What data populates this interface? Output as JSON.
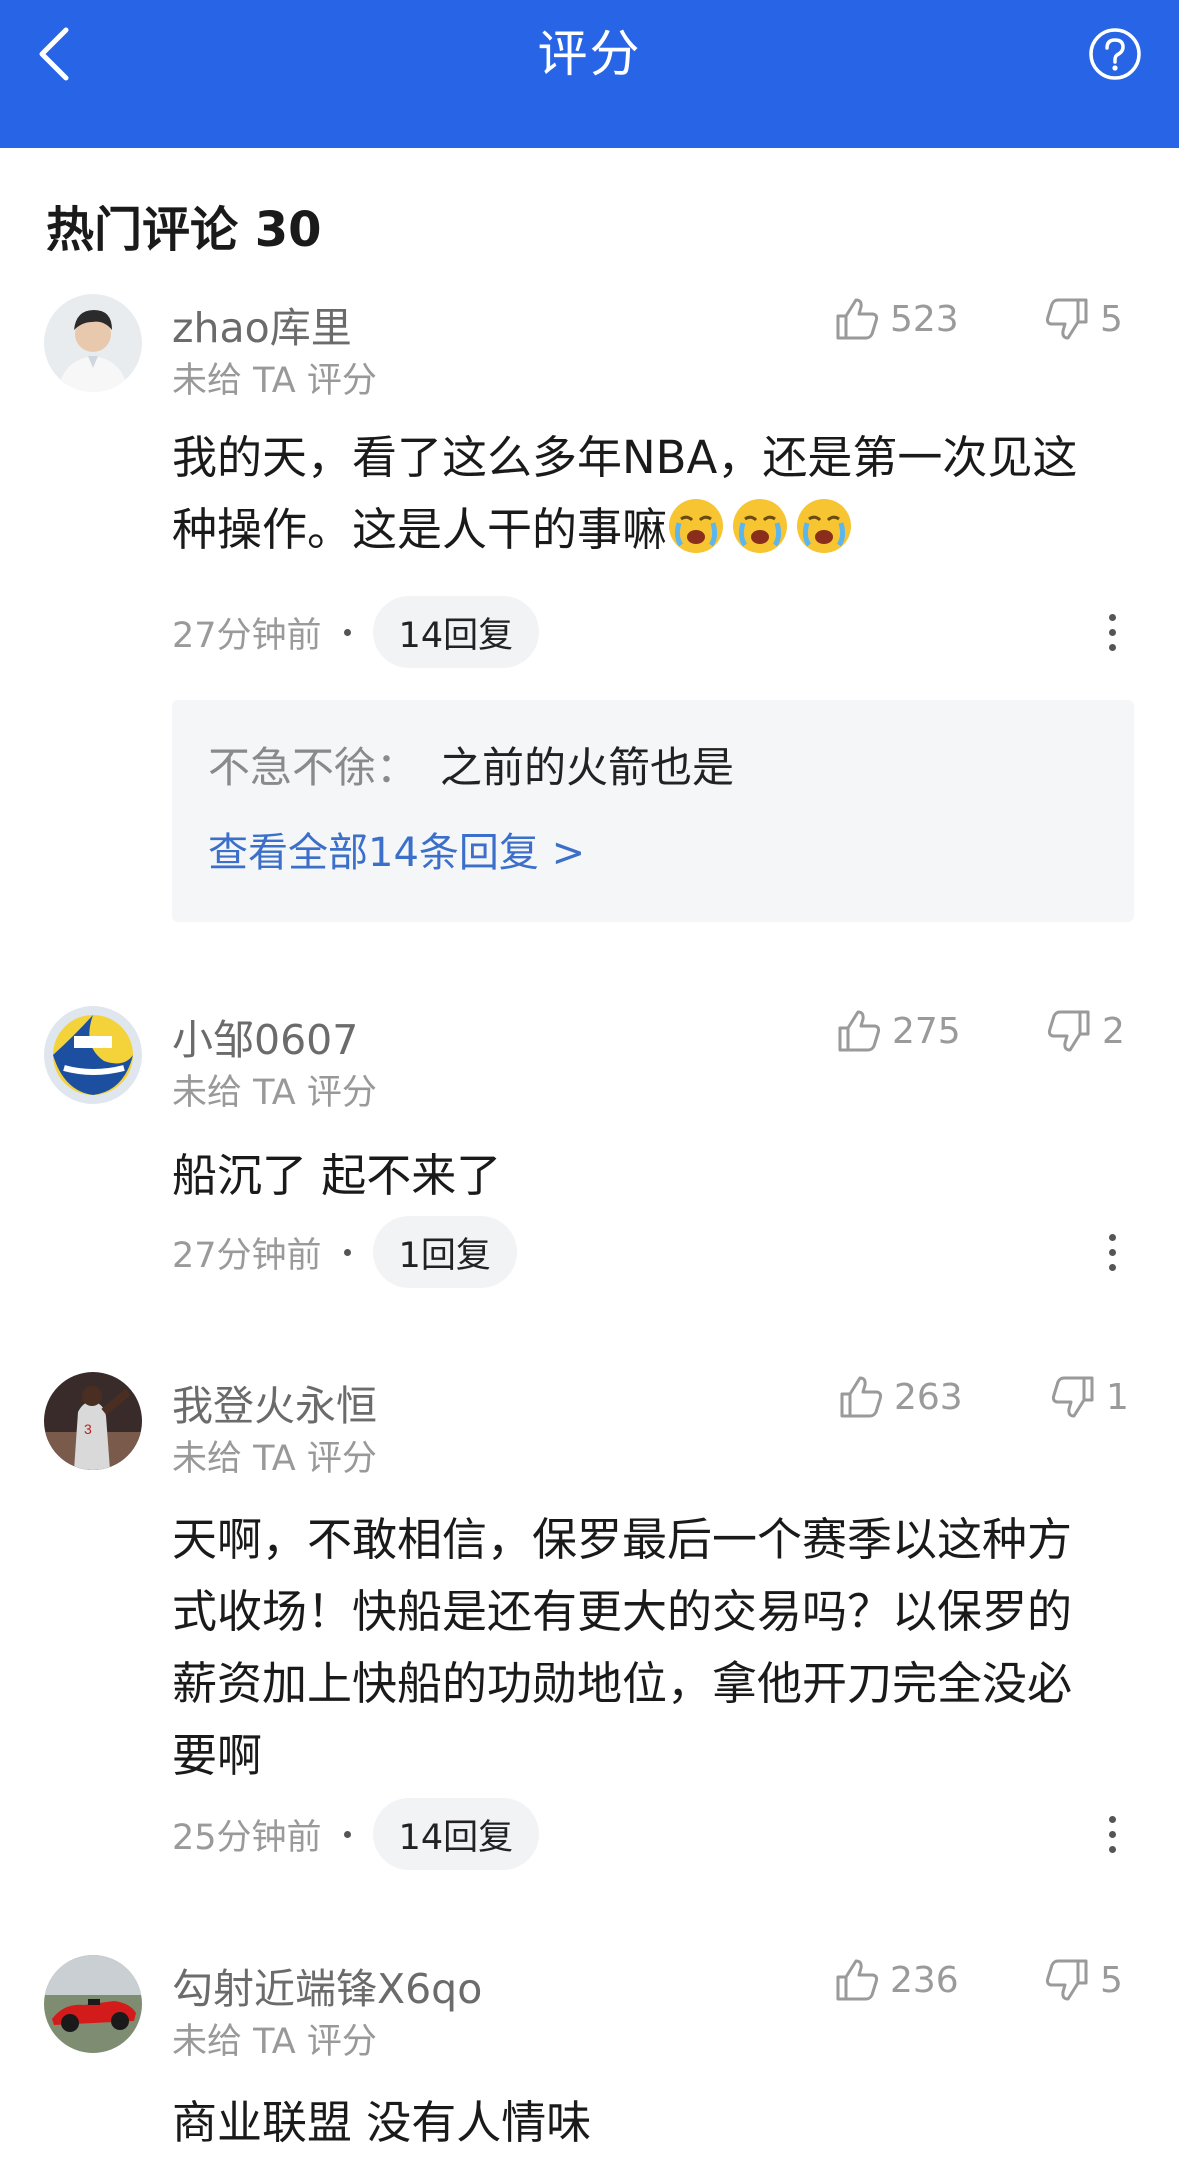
{
  "nav": {
    "title": "评分",
    "back_icon": "chevron-left-icon",
    "help_icon": "question-circle-icon",
    "color": "#2765e6"
  },
  "section": {
    "title": "热门评论 30"
  },
  "comments": [
    {
      "username": "zhao库里",
      "rating": "未给 TA 评分",
      "likes": "523",
      "dislikes": "5",
      "text": "我的天，看了这么多年NBA，还是第一次见这种操作。这是人干的事嘛",
      "time": "27分钟前",
      "replies": "14回复",
      "preview": {
        "author": "不急不徐：",
        "text": "之前的火箭也是",
        "link": "查看全部14条回复 >"
      }
    },
    {
      "username": "小邹0607",
      "rating": "未给 TA 评分",
      "likes": "275",
      "dislikes": "2",
      "text": "船沉了 起不来了",
      "time": "27分钟前",
      "replies": "1回复"
    },
    {
      "username": "我登火永恒",
      "rating": "未给 TA 评分",
      "likes": "263",
      "dislikes": "1",
      "text": "天啊，不敢相信，保罗最后一个赛季以这种方式收场！快船是还有更大的交易吗？以保罗的薪资加上快船的功勋地位，拿他开刀完全没必要啊",
      "time": "25分钟前",
      "replies": "14回复"
    },
    {
      "username": "勾射近端锋X6qo",
      "rating": "未给 TA 评分",
      "likes": "236",
      "dislikes": "5",
      "text": "商业联盟 没有人情味"
    }
  ]
}
